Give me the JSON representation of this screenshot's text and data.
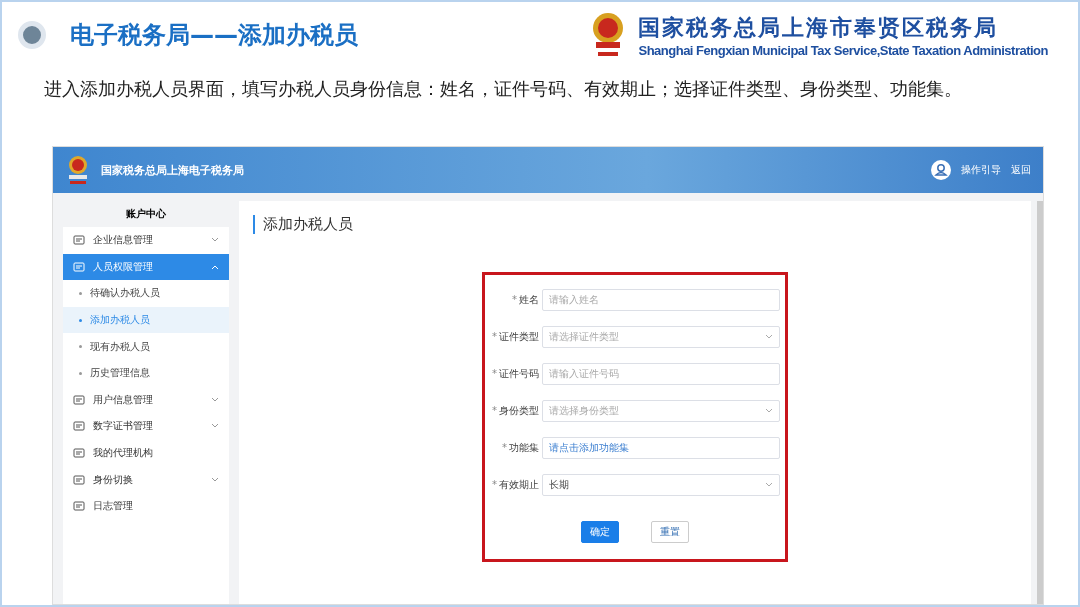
{
  "slide": {
    "title": "电子税务局——添加办税员",
    "org_name": "国家税务总局上海市奉贤区税务局",
    "org_name_en": "Shanghai Fengxian Municipal Tax Service,State Taxation Administration",
    "description": "进入添加办税人员界面，填写办税人员身份信息：姓名，证件号码、有效期止；选择证件类型、身份类型、功能集。"
  },
  "screen": {
    "banner": {
      "title": "国家税务总局上海电子税务局",
      "links": [
        "操作引导",
        "返回"
      ]
    },
    "sidebar": {
      "heading": "账户中心",
      "items": [
        {
          "label": "企业信息管理",
          "expanded": false,
          "selected": false
        },
        {
          "label": "人员权限管理",
          "expanded": true,
          "selected": true,
          "children": [
            {
              "label": "待确认办税人员",
              "selected": false
            },
            {
              "label": "添加办税人员",
              "selected": true
            },
            {
              "label": "现有办税人员",
              "selected": false
            },
            {
              "label": "历史管理信息",
              "selected": false
            }
          ]
        },
        {
          "label": "用户信息管理",
          "expanded": false,
          "selected": false
        },
        {
          "label": "数字证书管理",
          "expanded": false,
          "selected": false
        },
        {
          "label": "我的代理机构",
          "selected": false
        },
        {
          "label": "身份切换",
          "expanded": false,
          "selected": false
        },
        {
          "label": "日志管理",
          "selected": false
        }
      ]
    },
    "page_title": "添加办税人员",
    "form": {
      "fields": [
        {
          "kind": "input",
          "marker": "*",
          "label": "姓名",
          "placeholder": "请输入姓名"
        },
        {
          "kind": "select",
          "marker": "*",
          "label": "证件类型",
          "placeholder": "请选择证件类型"
        },
        {
          "kind": "input",
          "marker": "*",
          "label": "证件号码",
          "placeholder": "请输入证件号码"
        },
        {
          "kind": "select",
          "marker": "*",
          "label": "身份类型",
          "placeholder": "请选择身份类型"
        },
        {
          "kind": "picker",
          "marker": "*",
          "label": "功能集",
          "placeholder": "请点击添加功能集"
        },
        {
          "kind": "select",
          "marker": "*",
          "label": "有效期止",
          "value": "长期"
        }
      ],
      "buttons": [
        {
          "label": "确定",
          "kind": "primary"
        },
        {
          "label": "重置",
          "kind": "default"
        }
      ]
    }
  }
}
